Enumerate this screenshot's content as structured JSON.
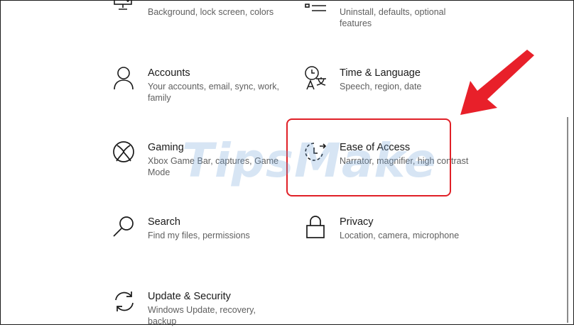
{
  "colors": {
    "highlight": "#e02027",
    "arrow": "#e8202a",
    "watermark": "#6ea0d7"
  },
  "watermark": "TipsMake",
  "tiles": [
    {
      "id": "personalization",
      "icon": "monitor-pen-icon",
      "title": "",
      "desc": "Background, lock screen, colors"
    },
    {
      "id": "apps",
      "icon": "apps-list-icon",
      "title": "",
      "desc": "Uninstall, defaults, optional features"
    },
    {
      "id": "accounts",
      "icon": "person-icon",
      "title": "Accounts",
      "desc": "Your accounts, email, sync, work, family"
    },
    {
      "id": "time-language",
      "icon": "time-language-icon",
      "title": "Time & Language",
      "desc": "Speech, region, date"
    },
    {
      "id": "gaming",
      "icon": "xbox-icon",
      "title": "Gaming",
      "desc": "Xbox Game Bar, captures, Game Mode"
    },
    {
      "id": "ease-of-access",
      "icon": "ease-of-access-icon",
      "title": "Ease of Access",
      "desc": "Narrator, magnifier, high contrast"
    },
    {
      "id": "search",
      "icon": "search-icon",
      "title": "Search",
      "desc": "Find my files, permissions"
    },
    {
      "id": "privacy",
      "icon": "lock-icon",
      "title": "Privacy",
      "desc": "Location, camera, microphone"
    },
    {
      "id": "update-security",
      "icon": "sync-icon",
      "title": "Update & Security",
      "desc": "Windows Update, recovery, backup"
    }
  ]
}
